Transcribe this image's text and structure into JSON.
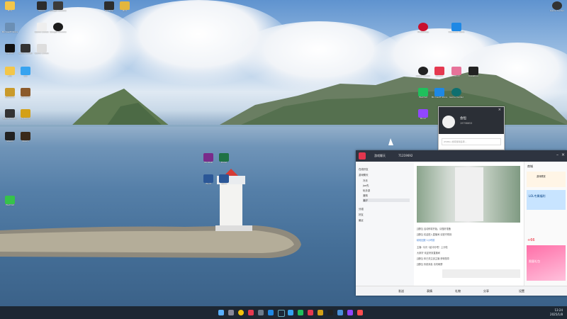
{
  "desktop": {
    "icons": [
      {
        "label": "Bild",
        "icon": "folder-icon",
        "color": "#f3c64a"
      },
      {
        "label": "Steam",
        "icon": "app-icon",
        "color": "#2c2c2c"
      },
      {
        "label": "Google Chrome",
        "icon": "app-icon",
        "color": "#3b3b3b"
      },
      {
        "label": "Winamp",
        "icon": "app-icon",
        "color": "#2d2d2d"
      },
      {
        "label": "CapCut",
        "icon": "app-icon",
        "color": "#111"
      },
      {
        "label": "QQ",
        "icon": "app-icon",
        "color": "#36a3f0"
      },
      {
        "label": "WeGame",
        "icon": "app-icon",
        "color": "#c99a2b"
      },
      {
        "label": "WinRAR",
        "icon": "app-icon",
        "color": "#7a2b8a"
      },
      {
        "label": "Word",
        "icon": "doc-icon",
        "color": "#2b5797"
      },
      {
        "label": "Excel",
        "icon": "doc-icon",
        "color": "#1f7244"
      },
      {
        "label": "Photoshop",
        "icon": "app-icon",
        "color": "#c8102e"
      },
      {
        "label": "Microsoft Store",
        "icon": "app-icon",
        "color": "#1e88e5"
      },
      {
        "label": "Game Center",
        "icon": "app-icon",
        "color": "#333"
      },
      {
        "label": "Douyin",
        "icon": "app-icon",
        "color": "#e53950"
      },
      {
        "label": "Bilibili",
        "icon": "app-icon",
        "color": "#e7739a"
      },
      {
        "label": "Kuaishou",
        "icon": "app-icon",
        "color": "#222"
      },
      {
        "label": "WeChat",
        "icon": "app-icon",
        "color": "#20c05c"
      },
      {
        "label": "Music",
        "icon": "app-icon",
        "color": "#9146ff"
      }
    ]
  },
  "taskbar": {
    "time": "13:24",
    "date": "2025/1/8",
    "apps": [
      "start-icon",
      "search-icon",
      "chrome-icon",
      "explorer-icon",
      "settings-icon",
      "store-icon",
      "steam-icon",
      "qq-icon",
      "wechat-icon",
      "music-icon",
      "game-icon",
      "terminal-icon",
      "mail-icon",
      "photos-icon",
      "video-icon"
    ]
  },
  "popup": {
    "name": "会恒",
    "id": "19798653",
    "input_placeholder": "(PUBG) 搜索游戏名称..."
  },
  "chat": {
    "title": "游戏聊天",
    "room_id": "71219692",
    "group_header": "游戏聊天",
    "friends_title": "在线好友",
    "friends": [
      "冷月",
      "Joe先",
      "玩手游",
      "渡鸦",
      "潮汐"
    ],
    "sections": [
      "分组",
      "好友",
      "最近"
    ],
    "messages": [
      "[通知] 活动即将开始，请做好准备",
      "[通知] 欢迎进入直播间 请遵守规则",
      "主播: 今天一起冲分吧！上分啦",
      "大家好 欢迎来到直播间",
      "[通知] 你已关注该主播 获得勋章",
      "[通知] 系统消息 请勿刷屏",
      "精彩回放 1小时前"
    ],
    "bottom": [
      "发送",
      "表情",
      "礼物",
      "分享",
      "设置"
    ],
    "right": {
      "header": "商城",
      "item1": "游戏联赛",
      "item2": "LOL专属福利",
      "item3": "限量礼包",
      "price": "+66"
    }
  }
}
